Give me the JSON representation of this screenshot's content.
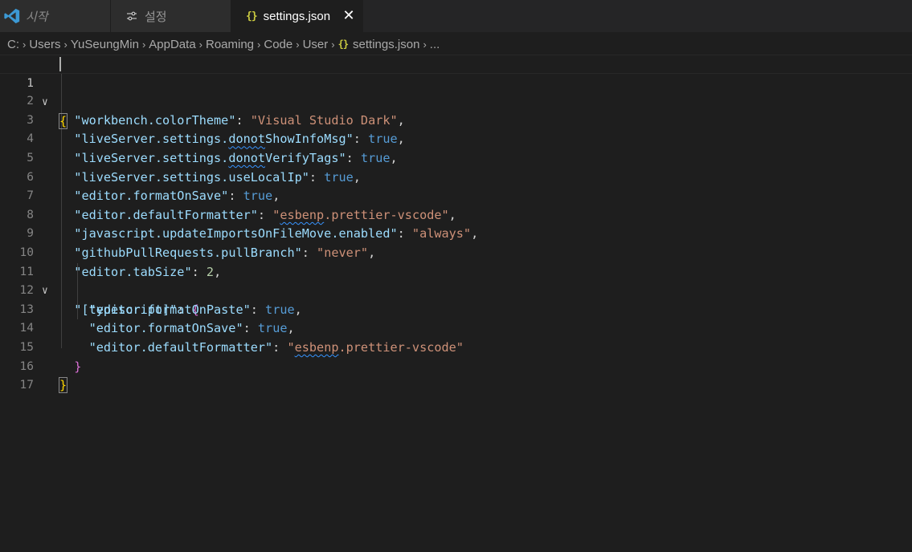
{
  "tabs": [
    {
      "label": "시작",
      "icon": "vscode-logo-icon"
    },
    {
      "label": "설정",
      "icon": "settings-sliders-icon"
    },
    {
      "label": "settings.json",
      "icon": "json-braces-icon",
      "active": true,
      "close": "✕"
    }
  ],
  "breadcrumb": {
    "parts": [
      "C:",
      "Users",
      "YuSeungMin",
      "AppData",
      "Roaming",
      "Code",
      "User",
      "settings.json",
      "..."
    ],
    "json_icon": "{}"
  },
  "editor": {
    "line_numbers": [
      "1",
      "2",
      "3",
      "4",
      "5",
      "6",
      "7",
      "8",
      "9",
      "10",
      "11",
      "12",
      "13",
      "14",
      "15",
      "16",
      "17"
    ],
    "fold_marker": "∨",
    "lines": {
      "l1_open": "{",
      "l2_key": "\"workbench.colorTheme\"",
      "l2_val": "\"Visual Studio Dark\"",
      "l3_key_a": "\"liveServer.settings.",
      "l3_key_b": "donot",
      "l3_key_c": "ShowInfoMsg\"",
      "l3_val": "true",
      "l4_key_a": "\"liveServer.settings.",
      "l4_key_b": "donot",
      "l4_key_c": "VerifyTags\"",
      "l4_val": "true",
      "l5_key": "\"liveServer.settings.useLocalIp\"",
      "l5_val": "true",
      "l6_key": "\"editor.formatOnSave\"",
      "l6_val": "true",
      "l7_key": "\"editor.defaultFormatter\"",
      "l7_val_a": "\"",
      "l7_val_b": "esbenp",
      "l7_val_c": ".prettier-vscode\"",
      "l8_key": "\"javascript.updateImportsOnFileMove.enabled\"",
      "l8_val": "\"always\"",
      "l9_key": "\"githubPullRequests.pullBranch\"",
      "l9_val": "\"never\"",
      "l10_key": "\"editor.tabSize\"",
      "l10_val": "2",
      "l11_key": "\"[typescript]\"",
      "l11_open": "{",
      "l12_key": "\"editor.formatOnPaste\"",
      "l12_val": "true",
      "l13_key": "\"editor.formatOnSave\"",
      "l13_val": "true",
      "l14_key": "\"editor.defaultFormatter\"",
      "l14_val_a": "\"",
      "l14_val_b": "esbenp",
      "l14_val_c": ".prettier-vscode\"",
      "l15_close": "}",
      "l16_close": "}",
      "colon": ": ",
      "comma": ","
    }
  },
  "colors": {
    "background": "#1e1e1e",
    "key": "#9cdcfe",
    "string": "#ce9178",
    "boolean": "#569cd6",
    "number": "#b5cea8",
    "brace_outer": "#ffd700",
    "brace_inner": "#da70d6",
    "squiggle": "#3794ff"
  }
}
